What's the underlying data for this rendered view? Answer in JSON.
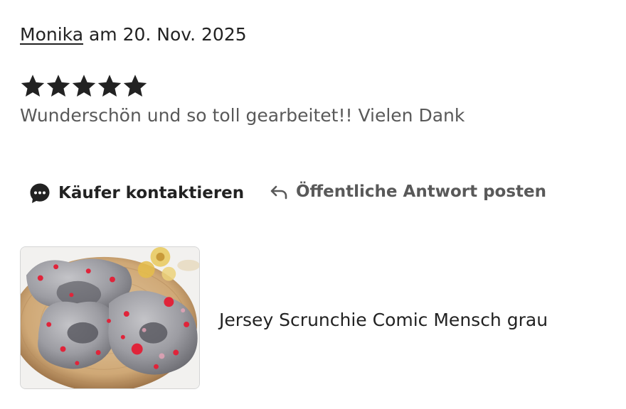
{
  "review": {
    "reviewer_name": "Monika",
    "date_text": " am 20. Nov. 2025",
    "rating": 5,
    "rating_max": 5,
    "text": "Wunderschön und so toll gearbeitet!! Vielen Dank"
  },
  "actions": {
    "contact_label": "Käufer kontaktieren",
    "reply_label": "Öffentliche Antwort posten"
  },
  "product": {
    "title": "Jersey Scrunchie Comic Mensch grau"
  },
  "icons": {
    "star": "star-icon",
    "contact": "chat-bubble-icon",
    "reply": "reply-arrow-icon"
  },
  "colors": {
    "text_primary": "#222222",
    "text_secondary": "#595959",
    "star": "#222222"
  }
}
